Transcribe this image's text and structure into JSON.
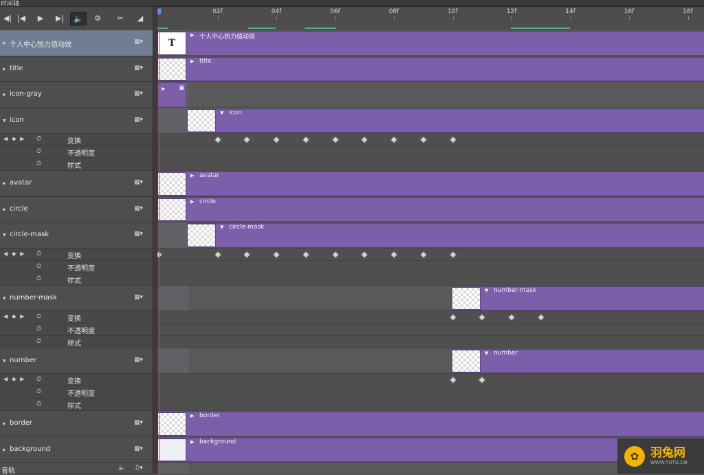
{
  "panel_title": "时间轴",
  "toolbar": {
    "go_start_icon": "skip-to-start-icon",
    "prev_frame_icon": "previous-frame-icon",
    "play_icon": "play-icon",
    "next_frame_icon": "next-frame-icon",
    "audio_icon": "speaker-icon",
    "settings_icon": "gear-icon",
    "split_icon": "scissors-icon",
    "transition_icon": "transition-icon"
  },
  "ruler": {
    "labels": [
      "02f",
      "04f",
      "06f",
      "08f",
      "10f",
      "12f",
      "14f",
      "16f",
      "18f"
    ]
  },
  "colors": {
    "bar": "#7c5eaa",
    "selected_row": "#6f7e92",
    "work_area": "#5da79c"
  },
  "props": {
    "transform": "变换",
    "opacity": "不透明度",
    "style": "样式"
  },
  "layers": [
    {
      "name": "个人中心热力值动效",
      "bar_label": "个人中心热力值动效",
      "thumb": "T"
    },
    {
      "name": "title",
      "bar_label": "title"
    },
    {
      "name": "icon-gray",
      "bar_label": ""
    },
    {
      "name": "icon",
      "bar_label": "icon"
    },
    {
      "name": "avatar",
      "bar_label": "avatar"
    },
    {
      "name": "circle",
      "bar_label": "circle"
    },
    {
      "name": "circle-mask",
      "bar_label": "circle-mask"
    },
    {
      "name": "number-mask",
      "bar_label": "number-mask"
    },
    {
      "name": "number",
      "bar_label": "number"
    },
    {
      "name": "border",
      "bar_label": "border"
    },
    {
      "name": "background",
      "bar_label": "background"
    }
  ],
  "audio_track": {
    "name": "音轨"
  },
  "keyframes": {
    "icon": [
      "02f",
      "03f",
      "04f",
      "05f",
      "06f",
      "07f",
      "08f",
      "09f",
      "10f"
    ],
    "circle-mask": [
      "00f",
      "02f",
      "03f",
      "04f",
      "05f",
      "06f",
      "07f",
      "08f",
      "09f",
      "10f"
    ],
    "number-mask": [
      "10f",
      "11f",
      "12f",
      "13f"
    ],
    "number": [
      "10f",
      "11f"
    ]
  },
  "watermark": {
    "main": "羽兔网",
    "url": "WWW.YUTU.CN"
  }
}
